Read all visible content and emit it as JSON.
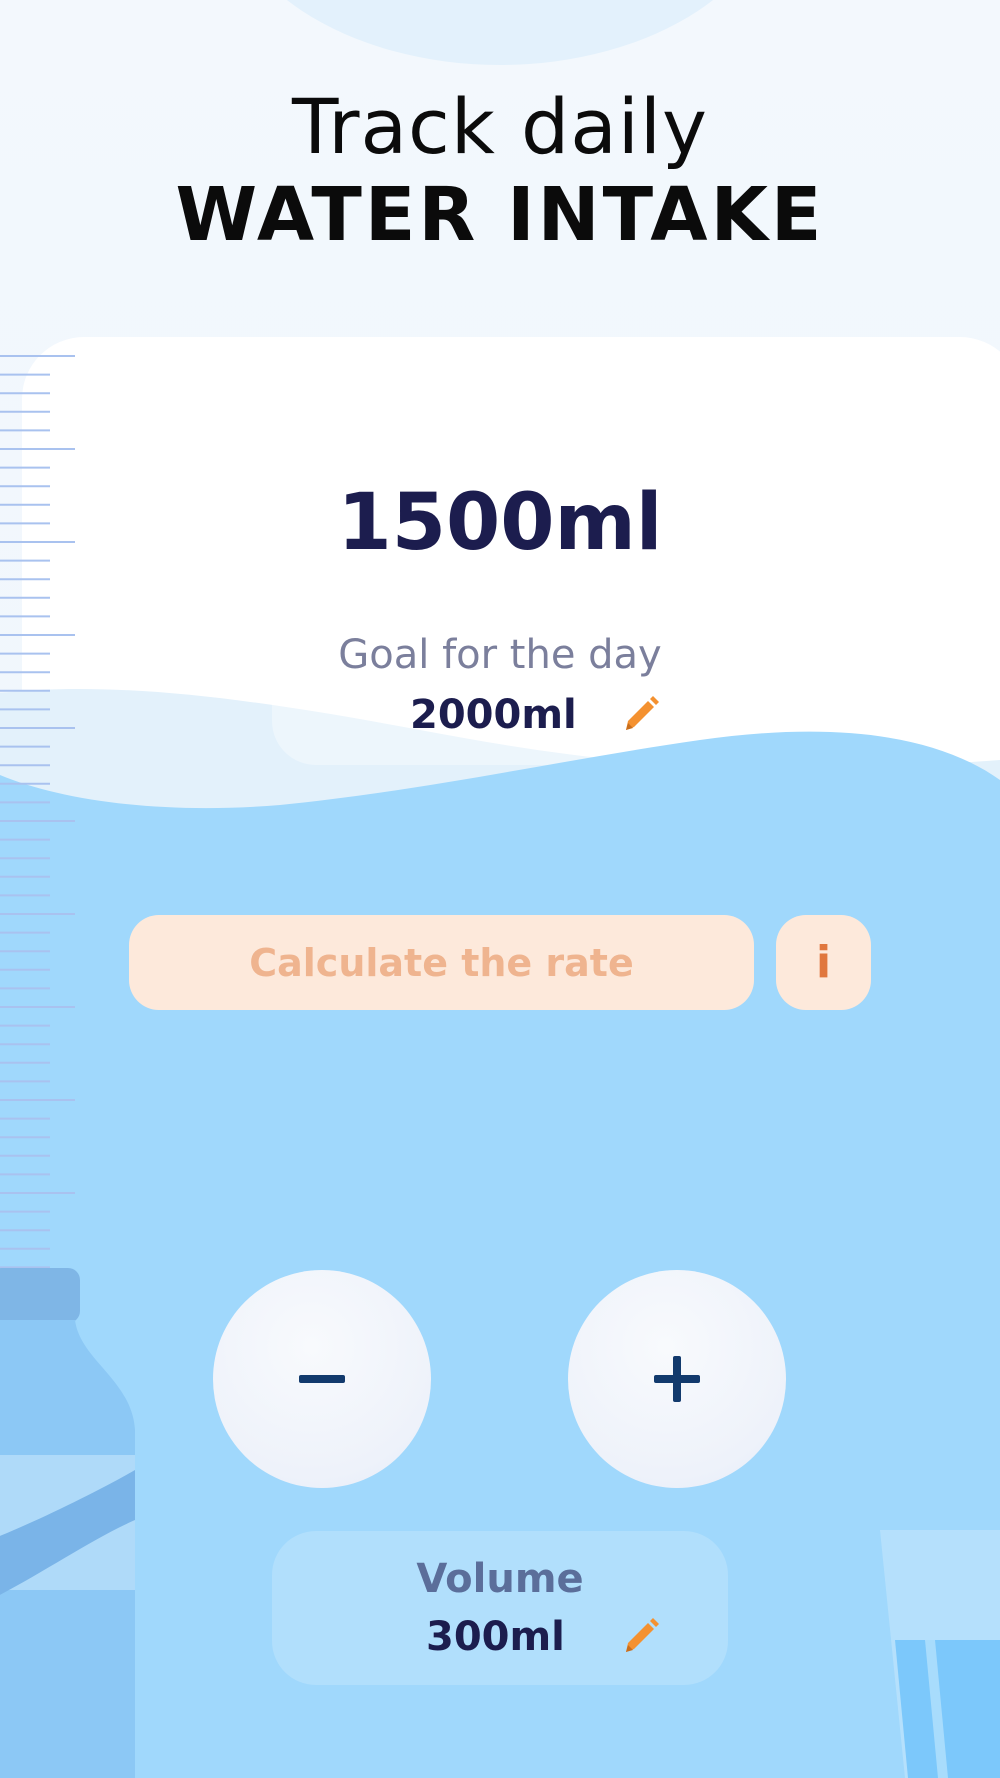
{
  "header": {
    "title_line1": "Track daily",
    "title_line2": "WATER INTAKE"
  },
  "tracker": {
    "current_intake": "1500ml",
    "goal_label": "Goal for the day",
    "goal_value": "2000ml",
    "calculate_button_label": "Calculate the rate",
    "info_button_label": "i",
    "volume_label": "Volume",
    "volume_value": "300ml"
  },
  "icons": {
    "edit": "pencil-icon",
    "decrease": "minus-icon",
    "increase": "plus-icon"
  },
  "colors": {
    "water": "#a0d8fc",
    "accent_orange": "#f49130",
    "dark_navy": "#1c1d4e",
    "button_peach": "#fde9db"
  }
}
